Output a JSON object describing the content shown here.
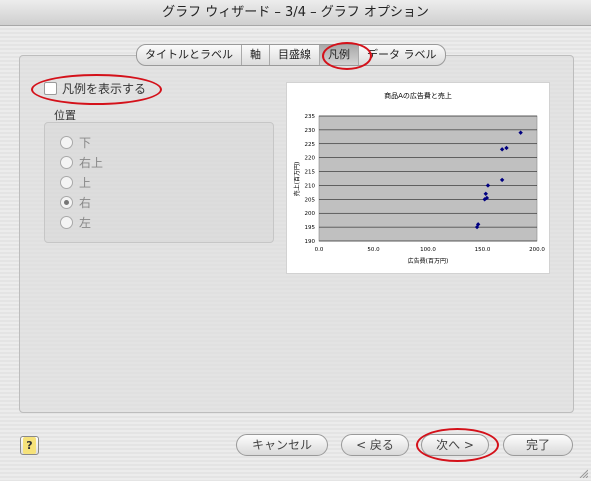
{
  "window": {
    "title": "グラフ ウィザード – 3/4 – グラフ オプション"
  },
  "tabs": [
    {
      "label": "タイトルとラベル",
      "active": false
    },
    {
      "label": "軸",
      "active": false
    },
    {
      "label": "目盛線",
      "active": false
    },
    {
      "label": "凡例",
      "active": true
    },
    {
      "label": "データ ラベル",
      "active": false
    }
  ],
  "legend": {
    "show_label": "凡例を表示する",
    "show_checked": false,
    "position_label": "位置",
    "positions": [
      {
        "label": "下",
        "checked": false
      },
      {
        "label": "右上",
        "checked": false
      },
      {
        "label": "上",
        "checked": false
      },
      {
        "label": "右",
        "checked": true
      },
      {
        "label": "左",
        "checked": false
      }
    ]
  },
  "chart_data": {
    "type": "scatter",
    "title": "商品Aの広告費と売上",
    "xlabel": "広告費(百万円)",
    "ylabel": "売上(百万円)",
    "xlim": [
      0,
      200
    ],
    "ylim": [
      190,
      235
    ],
    "x_ticks": [
      0,
      50,
      100,
      150,
      200
    ],
    "y_ticks": [
      190,
      195,
      200,
      205,
      210,
      215,
      220,
      225,
      230,
      235
    ],
    "grid": "horizontal",
    "plot_background": "#c0c0c0",
    "marker_color": "#000080",
    "points": [
      [
        145,
        195
      ],
      [
        146,
        196
      ],
      [
        152,
        205
      ],
      [
        153,
        207
      ],
      [
        154,
        205.5
      ],
      [
        155,
        210
      ],
      [
        168,
        212
      ],
      [
        168,
        223
      ],
      [
        172,
        223.5
      ],
      [
        185,
        229
      ]
    ]
  },
  "buttons": {
    "help": "?",
    "cancel": "キャンセル",
    "back": "< 戻る",
    "next": "次へ >",
    "finish": "完了"
  },
  "colors": {
    "annotation": "#d4111a"
  }
}
